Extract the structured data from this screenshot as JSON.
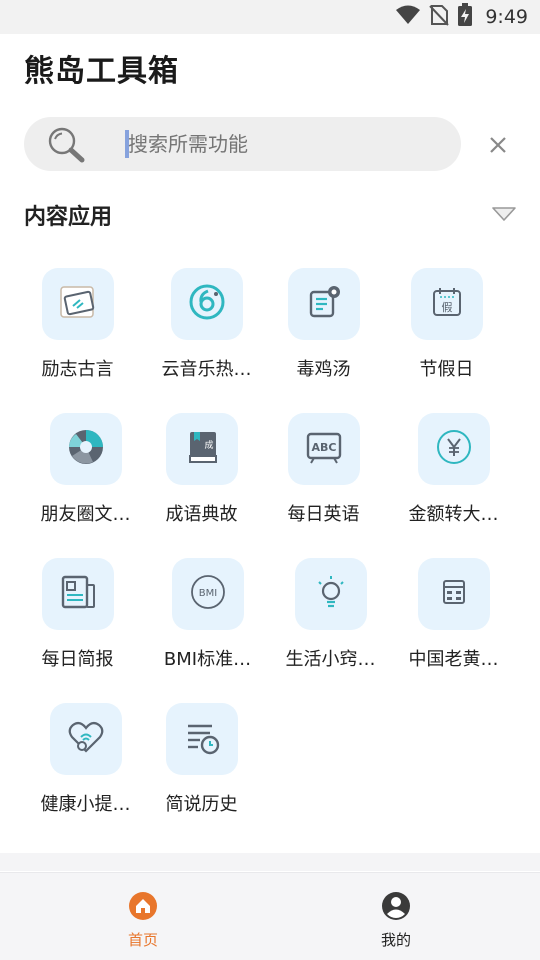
{
  "status_bar": {
    "time": "9:49"
  },
  "header": {
    "title": "熊岛工具箱"
  },
  "search": {
    "placeholder": "搜索所需功能"
  },
  "section": {
    "title": "内容应用"
  },
  "tools": [
    {
      "label": "励志古言",
      "icon": "quote-card-icon"
    },
    {
      "label": "云音乐热…",
      "icon": "music-disc-icon"
    },
    {
      "label": "毒鸡汤",
      "icon": "poison-soup-icon"
    },
    {
      "label": "节假日",
      "icon": "calendar-holiday-icon"
    },
    {
      "label": "朋友圈文…",
      "icon": "aperture-icon"
    },
    {
      "label": "成语典故",
      "icon": "idiom-book-icon"
    },
    {
      "label": "每日英语",
      "icon": "abc-board-icon"
    },
    {
      "label": "金额转大…",
      "icon": "yen-coin-icon"
    },
    {
      "label": "每日简报",
      "icon": "newspaper-icon"
    },
    {
      "label": "BMI标准…",
      "icon": "bmi-scale-icon"
    },
    {
      "label": "生活小窍…",
      "icon": "lightbulb-icon"
    },
    {
      "label": "中国老黄…",
      "icon": "almanac-icon"
    },
    {
      "label": "健康小提…",
      "icon": "health-heart-icon"
    },
    {
      "label": "简说历史",
      "icon": "history-list-icon"
    }
  ],
  "bottom_nav": {
    "home_label": "首页",
    "mine_label": "我的",
    "active": "home"
  },
  "colors": {
    "accent": "#e8762c",
    "tile_bg": "#e6f3fd",
    "icon_teal": "#2fb7c0",
    "icon_gray": "#5a6470"
  }
}
